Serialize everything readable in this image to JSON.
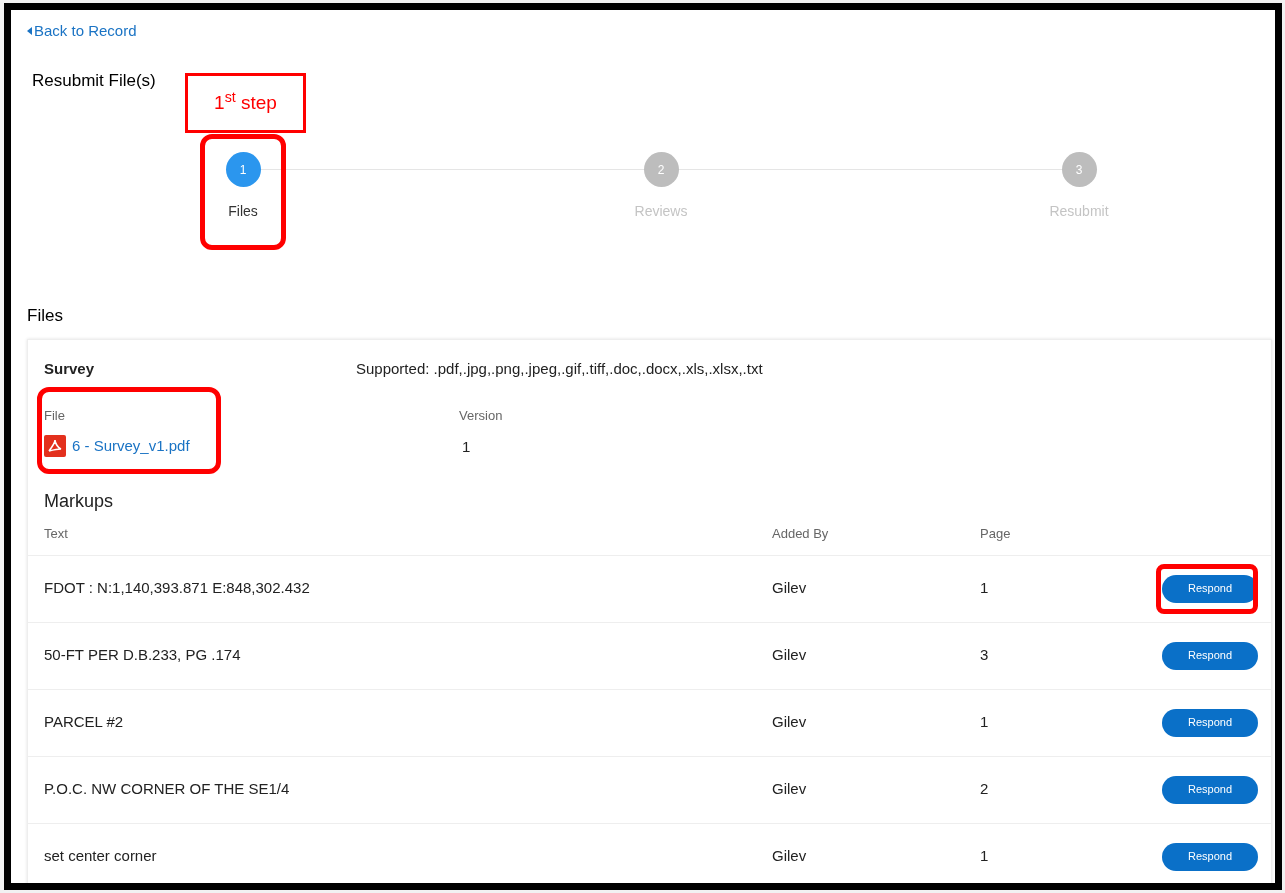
{
  "back_link": "Back to Record",
  "title": "Resubmit File(s)",
  "callout": "1$^{st}$ step",
  "steps": [
    {
      "number": "1",
      "label": "Files",
      "selected": true,
      "highlighted": true
    },
    {
      "number": "2",
      "label": "Reviews",
      "selected": false,
      "highlighted": false
    },
    {
      "number": "3",
      "label": "Resubmit",
      "selected": false,
      "highlighted": false
    }
  ],
  "section_title": "Files",
  "card": {
    "name": "Survey",
    "supported": "Supported: .pdf,.jpg,.png,.jpeg,.gif,.tiff,.doc,.docx,.xls,.xlsx,.txt",
    "file_label": "File",
    "file_name": "6 - Survey_v1.pdf",
    "file_highlighted": true,
    "version_label": "Version",
    "version": "1"
  },
  "markups": {
    "title": "Markups",
    "columns": [
      "Text",
      "Added By",
      "Page"
    ],
    "rows": [
      {
        "text": "FDOT : N:1,140,393.871 E:848,302.432",
        "added_by": "Gilev",
        "page": "1",
        "action": "Respond",
        "highlighted": true
      },
      {
        "text": "50-FT PER D.B.233, PG .174",
        "added_by": "Gilev",
        "page": "3",
        "action": "Respond",
        "highlighted": false
      },
      {
        "text": "PARCEL #2",
        "added_by": "Gilev",
        "page": "1",
        "action": "Respond",
        "highlighted": false
      },
      {
        "text": "P.O.C. NW CORNER OF THE SE1/4",
        "added_by": "Gilev",
        "page": "2",
        "action": "Respond",
        "highlighted": false
      },
      {
        "text": "set center corner",
        "added_by": "Gilev",
        "page": "1",
        "action": "Respond",
        "highlighted": false
      }
    ]
  }
}
